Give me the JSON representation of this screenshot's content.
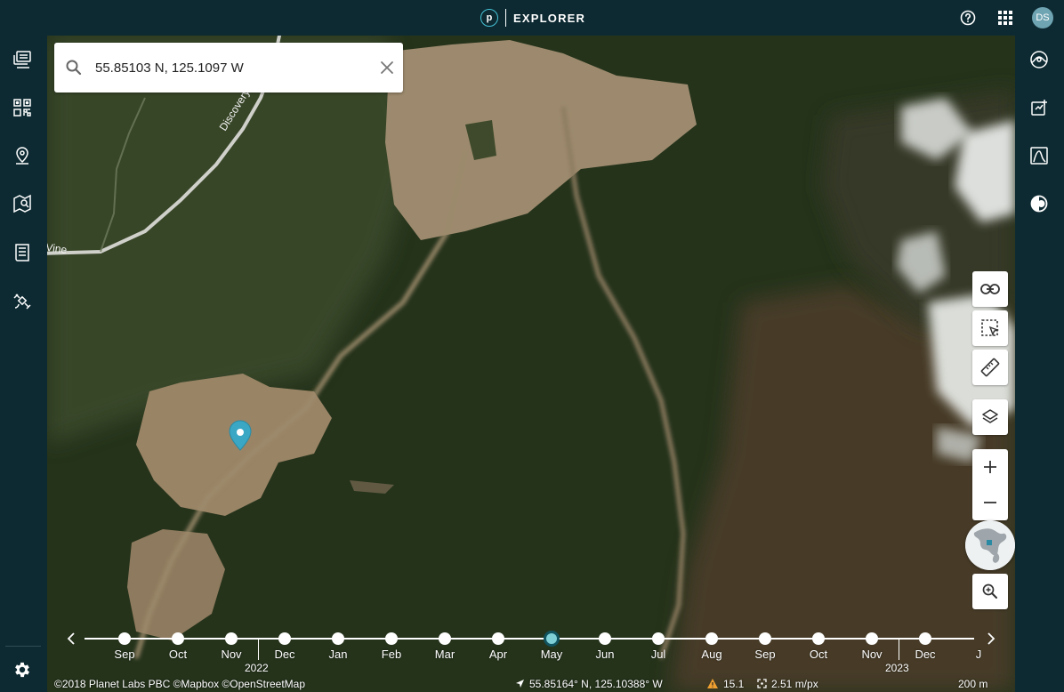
{
  "header": {
    "brand_initial": "p",
    "title": "EXPLORER",
    "user_initials": "DS",
    "help_icon": "help-icon",
    "apps_icon": "apps-grid-icon"
  },
  "sidebar_left": {
    "items": [
      {
        "name": "layers-stack-icon"
      },
      {
        "name": "mosaic-grid-icon"
      },
      {
        "name": "places-pin-icon"
      },
      {
        "name": "map-area-icon"
      },
      {
        "name": "orders-list-icon"
      },
      {
        "name": "tasking-satellite-icon"
      }
    ],
    "settings_icon": "gear-icon"
  },
  "sidebar_right": {
    "items": [
      {
        "name": "analysis-icon"
      },
      {
        "name": "compare-icon"
      },
      {
        "name": "chart-icon"
      },
      {
        "name": "brightness-icon"
      }
    ]
  },
  "search": {
    "value": "55.85103 N, 125.1097 W",
    "placeholder": "Search"
  },
  "map": {
    "road_labels": [
      "Discovery",
      "Vine"
    ],
    "colors": {
      "forest": "#25331b",
      "clearing": "#9d8a6e",
      "snow": "#e6e8e6",
      "marker": "#3aa7c4"
    }
  },
  "tools": {
    "link": "link-icon",
    "select": "select-area-icon",
    "measure": "ruler-icon",
    "layers": "layers-icon",
    "zoom_in": "+",
    "zoom_out": "−",
    "zoom_to": "zoom-search-icon"
  },
  "timeline": {
    "months": [
      "Sep",
      "Oct",
      "Nov",
      "Dec",
      "Jan",
      "Feb",
      "Mar",
      "Apr",
      "May",
      "Jun",
      "Jul",
      "Aug",
      "Sep",
      "Oct",
      "Nov",
      "Dec",
      "J"
    ],
    "active_month_index": 8,
    "years": [
      "2022",
      "2023"
    ]
  },
  "status": {
    "attribution": "©2018 Planet Labs PBC ©Mapbox ©OpenStreetMap",
    "coordinates": "55.85164° N, 125.10388° W",
    "cloud_value": "15.1",
    "resolution": "2.51 m/px",
    "scale": "200 m"
  }
}
